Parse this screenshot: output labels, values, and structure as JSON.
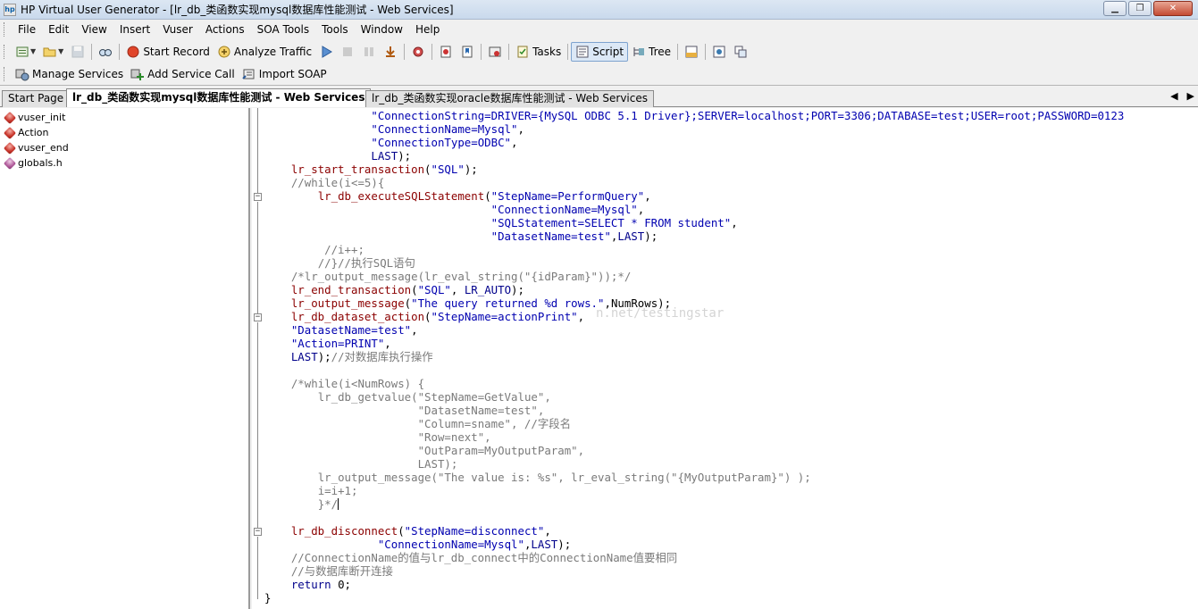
{
  "window": {
    "title": "HP Virtual User Generator - [lr_db_类函数实现mysql数据库性能测试 - Web Services]",
    "minimize_glyph": "▁",
    "maximize_glyph": "❐",
    "close_glyph": "✕"
  },
  "menu": [
    "File",
    "Edit",
    "View",
    "Insert",
    "Vuser",
    "Actions",
    "SOA Tools",
    "Tools",
    "Window",
    "Help"
  ],
  "toolbar1": {
    "start_record": "Start Record",
    "analyze_traffic": "Analyze Traffic",
    "tasks": "Tasks",
    "script": "Script",
    "tree": "Tree"
  },
  "toolbar2": {
    "manage_services": "Manage Services",
    "add_service_call": "Add Service Call",
    "import_soap": "Import SOAP"
  },
  "tabs": [
    "Start Page",
    "lr_db_类函数实现mysql数据库性能测试 - Web Services",
    "lr_db_类函数实现oracle数据库性能测试 - Web Services"
  ],
  "tree": [
    "vuser_init",
    "Action",
    "vuser_end",
    "globals.h"
  ],
  "watermark": "n.net/testingstar",
  "colors": {
    "function": "#8b0000",
    "string": "#0000b0",
    "comment": "#7a7a7a"
  },
  "code": [
    {
      "i": "                ",
      "p": [
        {
          "c": "st",
          "t": "\"ConnectionString=DRIVER={MySQL ODBC 5.1 Driver};SERVER=localhost;PORT=3306;DATABASE=test;USER=root;PASSWORD=0123"
        }
      ]
    },
    {
      "i": "                ",
      "p": [
        {
          "c": "st",
          "t": "\"ConnectionName=Mysql\""
        },
        {
          "c": "pl",
          "t": ","
        }
      ]
    },
    {
      "i": "                ",
      "p": [
        {
          "c": "st",
          "t": "\"ConnectionType=ODBC\""
        },
        {
          "c": "pl",
          "t": ","
        }
      ]
    },
    {
      "i": "                ",
      "p": [
        {
          "c": "kw",
          "t": "LAST"
        },
        {
          "c": "pl",
          "t": ");"
        }
      ]
    },
    {
      "i": "    ",
      "p": [
        {
          "c": "fn",
          "t": "lr_start_transaction"
        },
        {
          "c": "pl",
          "t": "("
        },
        {
          "c": "st",
          "t": "\"SQL\""
        },
        {
          "c": "pl",
          "t": ");"
        }
      ]
    },
    {
      "i": "    ",
      "p": [
        {
          "c": "cm",
          "t": "//while(i<=5){"
        }
      ]
    },
    {
      "i": "        ",
      "p": [
        {
          "c": "fn",
          "t": "lr_db_executeSQLStatement"
        },
        {
          "c": "pl",
          "t": "("
        },
        {
          "c": "st",
          "t": "\"StepName=PerformQuery\""
        },
        {
          "c": "pl",
          "t": ","
        }
      ]
    },
    {
      "i": "                                  ",
      "p": [
        {
          "c": "st",
          "t": "\"ConnectionName=Mysql\""
        },
        {
          "c": "pl",
          "t": ","
        }
      ]
    },
    {
      "i": "                                  ",
      "p": [
        {
          "c": "st",
          "t": "\"SQLStatement=SELECT * FROM student\""
        },
        {
          "c": "pl",
          "t": ","
        }
      ]
    },
    {
      "i": "                                  ",
      "p": [
        {
          "c": "st",
          "t": "\"DatasetName=test\""
        },
        {
          "c": "pl",
          "t": ","
        },
        {
          "c": "kw",
          "t": "LAST"
        },
        {
          "c": "pl",
          "t": ");"
        }
      ]
    },
    {
      "i": "         ",
      "p": [
        {
          "c": "cm",
          "t": "//i++;"
        }
      ]
    },
    {
      "i": "        ",
      "p": [
        {
          "c": "cm",
          "t": "//}//执行SQL语句"
        }
      ]
    },
    {
      "i": "    ",
      "p": [
        {
          "c": "cm",
          "t": "/*lr_output_message(lr_eval_string(\"{idParam}\"));*/"
        }
      ]
    },
    {
      "i": "    ",
      "p": [
        {
          "c": "fn",
          "t": "lr_end_transaction"
        },
        {
          "c": "pl",
          "t": "("
        },
        {
          "c": "st",
          "t": "\"SQL\""
        },
        {
          "c": "pl",
          "t": ", "
        },
        {
          "c": "kw",
          "t": "LR_AUTO"
        },
        {
          "c": "pl",
          "t": ");"
        }
      ]
    },
    {
      "i": "    ",
      "p": [
        {
          "c": "fn",
          "t": "lr_output_message"
        },
        {
          "c": "pl",
          "t": "("
        },
        {
          "c": "st",
          "t": "\"The query returned %d rows.\""
        },
        {
          "c": "pl",
          "t": ",NumRows);"
        }
      ]
    },
    {
      "i": "    ",
      "p": [
        {
          "c": "fn",
          "t": "lr_db_dataset_action"
        },
        {
          "c": "pl",
          "t": "("
        },
        {
          "c": "st",
          "t": "\"StepName=actionPrint\""
        },
        {
          "c": "pl",
          "t": ","
        }
      ]
    },
    {
      "i": "    ",
      "p": [
        {
          "c": "st",
          "t": "\"DatasetName=test\""
        },
        {
          "c": "pl",
          "t": ","
        }
      ]
    },
    {
      "i": "    ",
      "p": [
        {
          "c": "st",
          "t": "\"Action=PRINT\""
        },
        {
          "c": "pl",
          "t": ","
        }
      ]
    },
    {
      "i": "    ",
      "p": [
        {
          "c": "kw",
          "t": "LAST"
        },
        {
          "c": "pl",
          "t": ");"
        },
        {
          "c": "cm",
          "t": "//对数据库执行操作"
        }
      ]
    },
    {
      "i": "",
      "p": []
    },
    {
      "i": "    ",
      "p": [
        {
          "c": "cm",
          "t": "/*while(i<NumRows) {"
        }
      ]
    },
    {
      "i": "        ",
      "p": [
        {
          "c": "cm",
          "t": "lr_db_getvalue(\"StepName=GetValue\","
        }
      ]
    },
    {
      "i": "                       ",
      "p": [
        {
          "c": "cm",
          "t": "\"DatasetName=test\","
        }
      ]
    },
    {
      "i": "                       ",
      "p": [
        {
          "c": "cm",
          "t": "\"Column=sname\", //字段名"
        }
      ]
    },
    {
      "i": "                       ",
      "p": [
        {
          "c": "cm",
          "t": "\"Row=next\","
        }
      ]
    },
    {
      "i": "                       ",
      "p": [
        {
          "c": "cm",
          "t": "\"OutParam=MyOutputParam\","
        }
      ]
    },
    {
      "i": "                       ",
      "p": [
        {
          "c": "cm",
          "t": "LAST);"
        }
      ]
    },
    {
      "i": "        ",
      "p": [
        {
          "c": "cm",
          "t": "lr_output_message(\"The value is: %s\", lr_eval_string(\"{MyOutputParam}\") );"
        }
      ]
    },
    {
      "i": "        ",
      "p": [
        {
          "c": "cm",
          "t": "i=i+1;"
        }
      ]
    },
    {
      "i": "        ",
      "p": [
        {
          "c": "cm",
          "t": "}*/"
        },
        {
          "c": "cursor",
          "t": ""
        }
      ]
    },
    {
      "i": "",
      "p": []
    },
    {
      "i": "    ",
      "p": [
        {
          "c": "fn",
          "t": "lr_db_disconnect"
        },
        {
          "c": "pl",
          "t": "("
        },
        {
          "c": "st",
          "t": "\"StepName=disconnect\""
        },
        {
          "c": "pl",
          "t": ","
        }
      ]
    },
    {
      "i": "                 ",
      "p": [
        {
          "c": "st",
          "t": "\"ConnectionName=Mysql\""
        },
        {
          "c": "pl",
          "t": ","
        },
        {
          "c": "kw",
          "t": "LAST"
        },
        {
          "c": "pl",
          "t": ");"
        }
      ]
    },
    {
      "i": "    ",
      "p": [
        {
          "c": "cm",
          "t": "//ConnectionName的值与lr_db_connect中的ConnectionName值要相同"
        }
      ]
    },
    {
      "i": "    ",
      "p": [
        {
          "c": "cm",
          "t": "//与数据库断开连接"
        }
      ]
    },
    {
      "i": "    ",
      "p": [
        {
          "c": "kw",
          "t": "return"
        },
        {
          "c": "pl",
          "t": " 0;"
        }
      ]
    },
    {
      "i": "",
      "p": [
        {
          "c": "pl",
          "t": "}"
        }
      ]
    }
  ]
}
